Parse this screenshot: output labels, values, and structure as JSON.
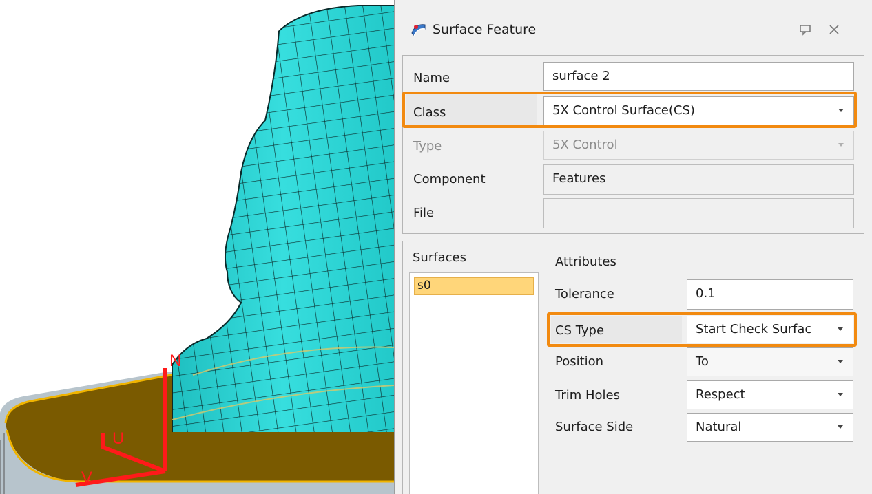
{
  "dialog": {
    "title": "Surface Feature",
    "title_icon": "surface-feature-icon",
    "controls": {
      "pin_icon": "pin-icon",
      "close_icon": "close-icon"
    }
  },
  "general": {
    "name_label": "Name",
    "name_value": "surface 2",
    "class_label": "Class",
    "class_value": "5X Control Surface(CS)",
    "type_label": "Type",
    "type_value": "5X Control",
    "component_label": "Component",
    "component_value": "Features",
    "file_label": "File",
    "file_value": ""
  },
  "surfaces": {
    "header": "Surfaces",
    "items": [
      "s0"
    ]
  },
  "attributes": {
    "header": "Attributes",
    "tolerance_label": "Tolerance",
    "tolerance_value": "0.1",
    "cs_type_label": "CS Type",
    "cs_type_value": "Start Check Surfac",
    "position_label": "Position",
    "position_value": "To",
    "trim_holes_label": "Trim Holes",
    "trim_holes_value": "Respect",
    "surface_side_label": "Surface Side",
    "surface_side_value": "Natural"
  },
  "viewport": {
    "axis_labels": {
      "n": "N",
      "u": "U",
      "v": "V"
    }
  },
  "colors": {
    "mesh": "#2ad4d4",
    "mesh_lines": "#0a2a2a",
    "axis": "#ff1a1a",
    "highlight": "#f28a10",
    "surface_top": "#7a5a00",
    "surface_edge": "#f0b400",
    "selection": "#ffd67a"
  }
}
